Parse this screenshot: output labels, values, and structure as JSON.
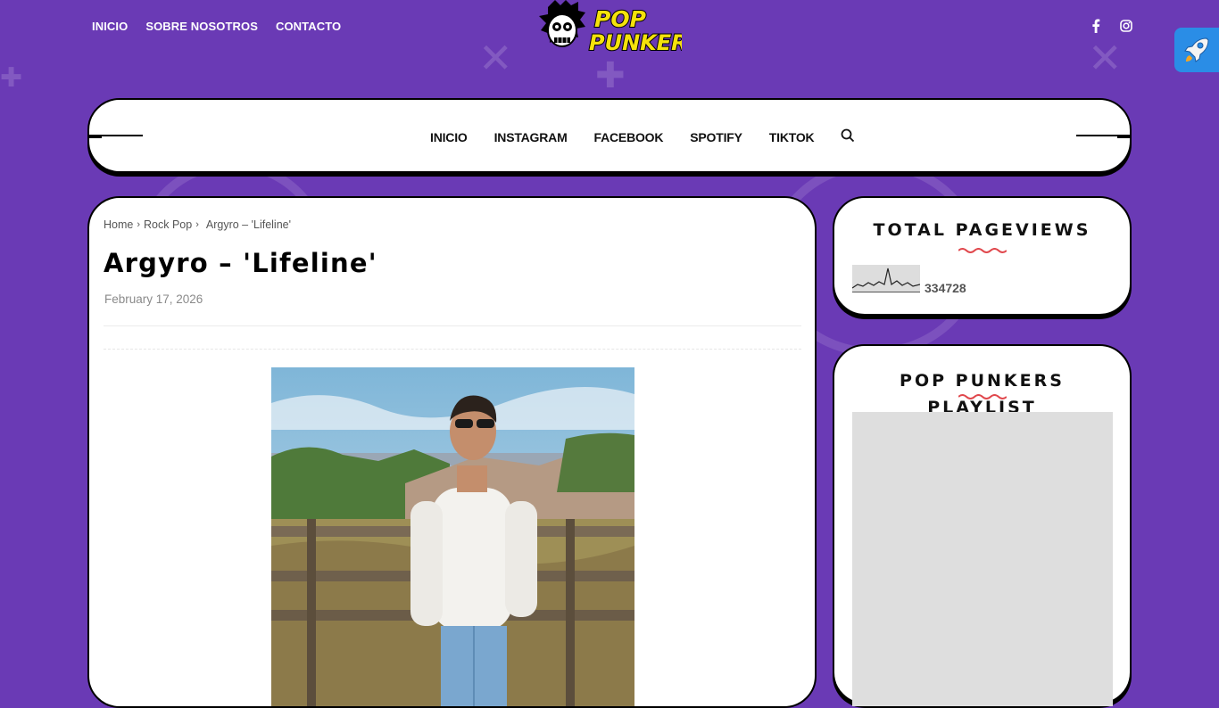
{
  "top_nav": {
    "items": [
      "INICIO",
      "SOBRE NOSOTROS",
      "CONTACTO"
    ]
  },
  "logo": {
    "text_line1": "POP",
    "text_line2": "PUNKERS"
  },
  "social": {
    "icons": [
      "facebook-icon",
      "instagram-icon"
    ]
  },
  "main_nav": {
    "items": [
      "INICIO",
      "INSTAGRAM",
      "FACEBOOK",
      "SPOTIFY",
      "TIKTOK"
    ],
    "search_icon": "search-icon"
  },
  "breadcrumb": {
    "home": "Home",
    "category": "Rock Pop",
    "current": "Argyro – 'Lifeline'"
  },
  "post": {
    "title": "Argyro – 'Lifeline'",
    "date": "February 17, 2026"
  },
  "widgets": {
    "pageviews": {
      "title": "TOTAL PAGEVIEWS",
      "count": "334728"
    },
    "playlist": {
      "title": "POP PUNKERS PLAYLIST"
    }
  },
  "colors": {
    "background": "#6a3ab5",
    "accent": "#e0474c",
    "rocket": "#2a8de6"
  }
}
